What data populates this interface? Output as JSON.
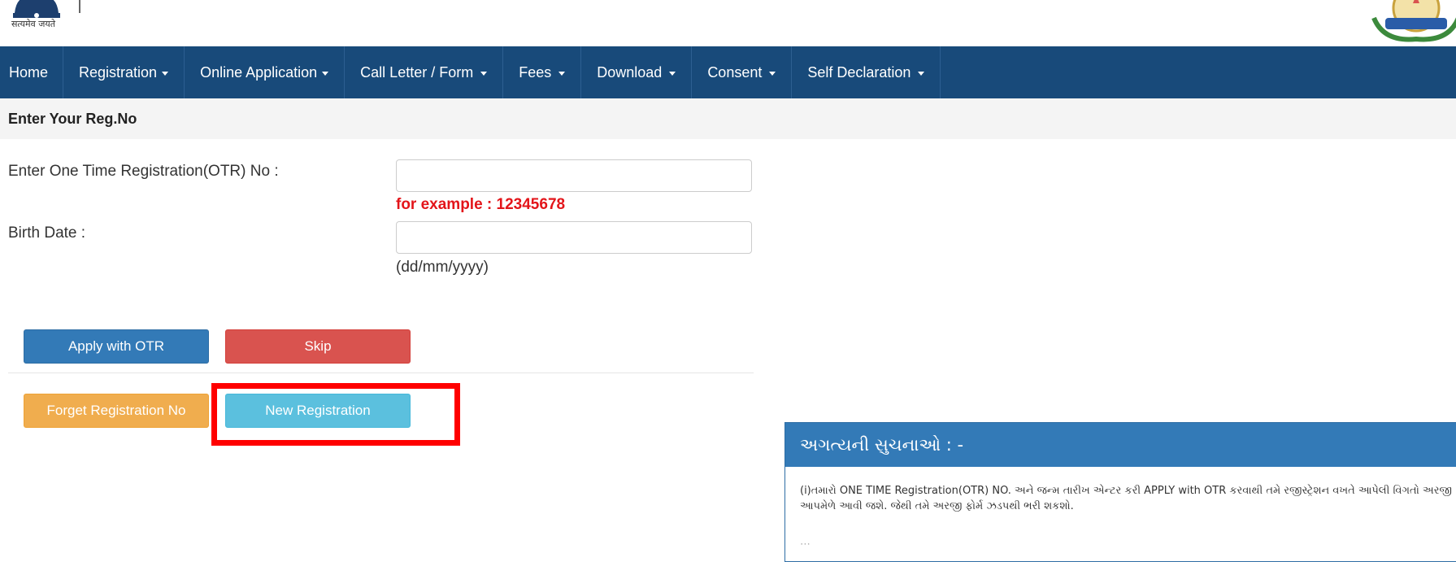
{
  "header": {
    "emblem_motto": "सत्यमेव जयते"
  },
  "nav": {
    "items": [
      {
        "label": "Home",
        "dropdown": false
      },
      {
        "label": "Registration",
        "dropdown": true
      },
      {
        "label": "Online Application",
        "dropdown": true
      },
      {
        "label": "Call Letter / Form",
        "dropdown": true
      },
      {
        "label": "Fees",
        "dropdown": true
      },
      {
        "label": "Download",
        "dropdown": true
      },
      {
        "label": "Consent",
        "dropdown": true
      },
      {
        "label": "Self Declaration",
        "dropdown": true
      }
    ]
  },
  "panel": {
    "title": "Enter Your Reg.No"
  },
  "form": {
    "otr_label": "Enter One Time Registration(OTR) No :",
    "otr_value": "",
    "otr_example": "for example : 12345678",
    "birth_label": "Birth Date :",
    "birth_value": "",
    "birth_hint": "(dd/mm/yyyy)"
  },
  "buttons": {
    "apply": "Apply with OTR",
    "skip": "Skip",
    "forget": "Forget Registration No",
    "new_registration": "New Registration"
  },
  "notice": {
    "title": "અગત્યની સુચનાઓ : -",
    "line1": "(i)તમારો ONE TIME Registration(OTR) NO. અને જન્મ તારીખ એન્ટર કરી APPLY with OTR કરવાથી તમે રજીસ્ટ્રેશન વખતે આપેલી વિગતો અરજી",
    "line2": "આપમેળે આવી જશે. જેથી તમે અરજી ફોર્મ ઝડપથી ભરી શકશો."
  },
  "colors": {
    "navbar": "#184a7a",
    "primary": "#337ab7",
    "danger": "#d9534f",
    "warning": "#f0ad4e",
    "info": "#5bc0de",
    "highlight": "#ff0000",
    "example_text": "#e3151a"
  }
}
